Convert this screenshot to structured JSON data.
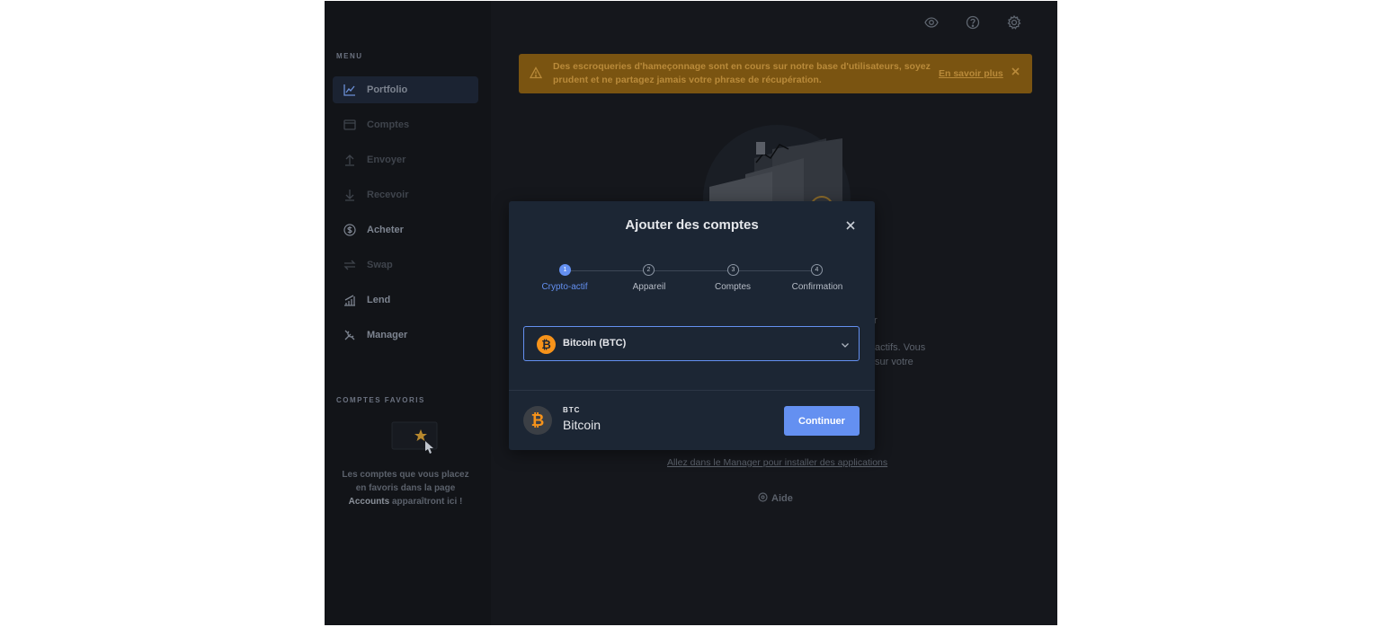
{
  "sidebar": {
    "menu_title": "MENU",
    "items": [
      {
        "label": "Portfolio",
        "icon": "chart-line-icon",
        "active": true
      },
      {
        "label": "Comptes",
        "icon": "wallet-icon"
      },
      {
        "label": "Envoyer",
        "icon": "arrow-up-icon"
      },
      {
        "label": "Recevoir",
        "icon": "arrow-down-icon"
      },
      {
        "label": "Acheter",
        "icon": "dollar-circle-icon"
      },
      {
        "label": "Swap",
        "icon": "swap-icon"
      },
      {
        "label": "Lend",
        "icon": "lend-chart-icon"
      },
      {
        "label": "Manager",
        "icon": "tools-icon"
      }
    ],
    "favorites_title": "COMPTES FAVORIS",
    "favorites_text_1": "Les comptes que vous placez en favoris dans la page",
    "favorites_text_bold": "Accounts",
    "favorites_text_2": "apparaîtront ici !"
  },
  "topbar": {
    "icons": [
      "eye-icon",
      "help-icon",
      "settings-icon"
    ]
  },
  "banner": {
    "text": "Des escroqueries d'hameçonnage sont en cours sur notre base d'utilisateurs, soyez prudent et ne partagez jamais votre phrase de récupération.",
    "link": "En savoir plus",
    "color": "#7a5411"
  },
  "background": {
    "frag_1": "r",
    "frag_2": "actifs. Vous",
    "frag_3": "sur votre",
    "manager_link": "Allez dans le Manager pour installer des applications",
    "help_label": "Aide"
  },
  "modal": {
    "title": "Ajouter des comptes",
    "steps": [
      {
        "number": "1",
        "label": "Crypto-actif",
        "active": true
      },
      {
        "number": "2",
        "label": "Appareil"
      },
      {
        "number": "3",
        "label": "Comptes"
      },
      {
        "number": "4",
        "label": "Confirmation"
      }
    ],
    "select_value": "Bitcoin (BTC)",
    "coin_symbol": "₿",
    "footer_ticker": "BTC",
    "footer_name": "Bitcoin",
    "continue_label": "Continuer",
    "accent": "#6490f1",
    "coin_color": "#f7931a"
  }
}
